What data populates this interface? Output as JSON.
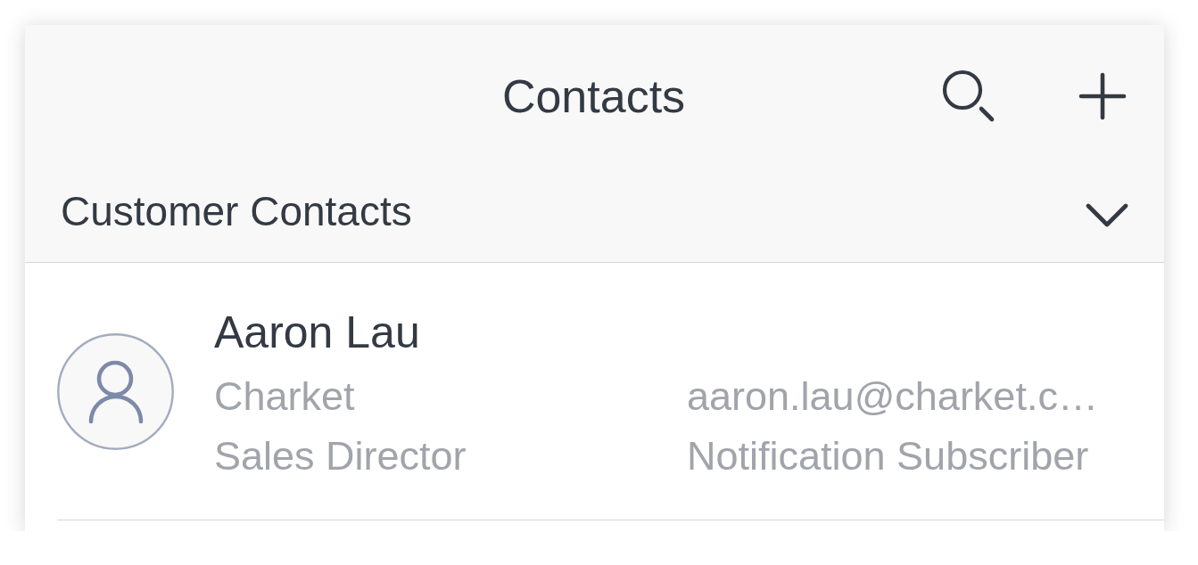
{
  "header": {
    "title": "Contacts",
    "actions": [
      {
        "kind": "search"
      },
      {
        "kind": "add"
      }
    ]
  },
  "filter": {
    "label": "Customer Contacts",
    "expanded": false
  },
  "contacts": [
    {
      "name": "Aaron Lau",
      "company": "Charket",
      "job_title": "Sales Director",
      "email": "aaron.lau@charket.c…",
      "role": "Notification Subscriber"
    }
  ]
}
